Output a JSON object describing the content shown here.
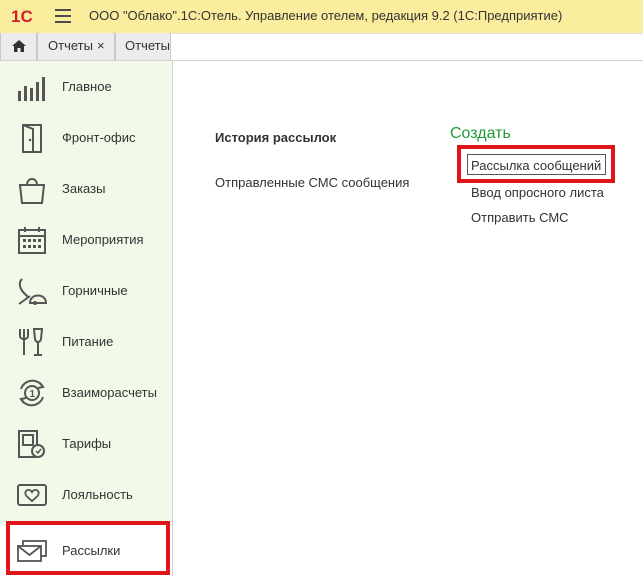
{
  "window": {
    "title": "ООО \"Облако\".1С:Отель. Управление отелем, редакция 9.2  (1С:Предприятие)",
    "logo_text": "1С"
  },
  "tabs": [
    {
      "label": "Отчеты",
      "close": "×"
    },
    {
      "label": "Отчеты"
    }
  ],
  "sidebar": {
    "items": [
      {
        "label": "Главное",
        "icon": "bar-chart-icon"
      },
      {
        "label": "Фронт-офис",
        "icon": "door-icon"
      },
      {
        "label": "Заказы",
        "icon": "shopping-bag-icon"
      },
      {
        "label": "Мероприятия",
        "icon": "calendar-icon"
      },
      {
        "label": "Горничные",
        "icon": "vacuum-cleaner-icon"
      },
      {
        "label": "Питание",
        "icon": "fork-glass-icon"
      },
      {
        "label": "Взаиморасчеты",
        "icon": "coin-cycle-icon"
      },
      {
        "label": "Тарифы",
        "icon": "tariff-icon"
      },
      {
        "label": "Лояльность",
        "icon": "heart-icon"
      },
      {
        "label": "Рассылки",
        "icon": "envelope-icon",
        "active": true
      }
    ]
  },
  "main": {
    "section_title": "История рассылок",
    "links": [
      "Отправленные СМС сообщения"
    ],
    "create": {
      "label": "Создать",
      "items": [
        "Рассылка сообщений",
        "Ввод опросного листа",
        "Отправить СМС"
      ]
    }
  },
  "colors": {
    "titlebar": "#fbed9e",
    "sidebar": "#f2f9e9",
    "accent_green": "#1f9a3a",
    "highlight_red": "#e0151c"
  }
}
